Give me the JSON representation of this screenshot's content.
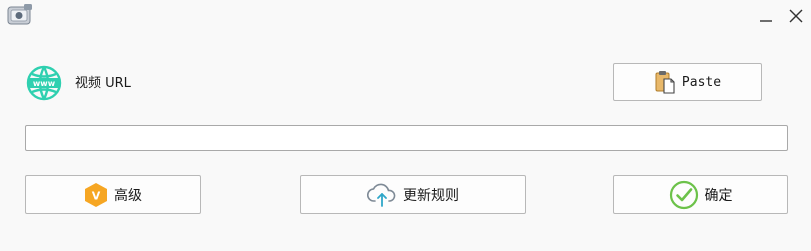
{
  "window": {
    "app_icon": "app-icon",
    "minimize_icon": "minimize-icon",
    "close_icon": "close-icon"
  },
  "url_section": {
    "icon": "globe-www-icon",
    "icon_text": "www",
    "label": "视频 URL",
    "input_value": "",
    "input_placeholder": ""
  },
  "buttons": {
    "paste": {
      "label": "Paste",
      "icon": "clipboard-icon"
    },
    "advanced": {
      "label": "高级",
      "icon": "vip-hexagon-icon",
      "icon_text": "V"
    },
    "update_rules": {
      "label": "更新规则",
      "icon": "cloud-upload-icon"
    },
    "confirm": {
      "label": "确定",
      "icon": "check-circle-icon"
    }
  },
  "colors": {
    "accent_teal": "#2fd0b0",
    "vip_orange": "#f6a623",
    "check_green": "#6cc24a",
    "cloud_blue": "#4a90c2"
  }
}
